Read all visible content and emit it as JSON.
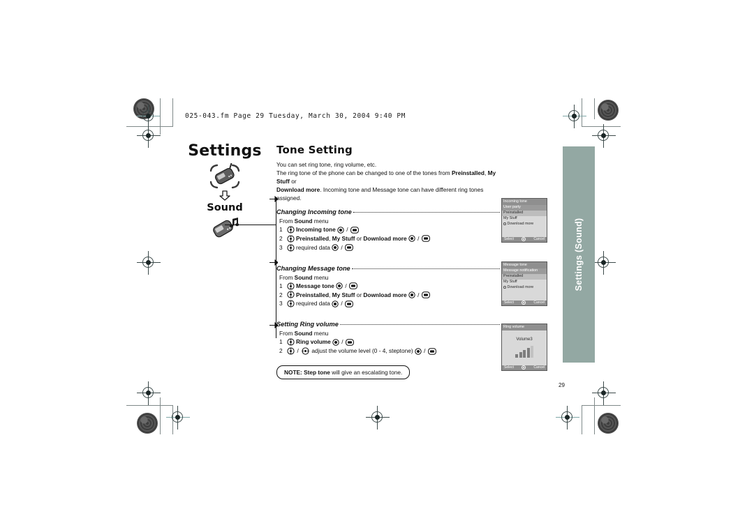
{
  "print_header": {
    "file_line": "025-043.fm  Page 29  Tuesday, March 30, 2004  9:40 PM"
  },
  "page_number": "29",
  "side_tab": {
    "label": "Settings (Sound)",
    "color": "#93a8a3"
  },
  "sidebar": {
    "chapter": "Settings",
    "arrow_icon": "down-arrow-icon",
    "section": "Sound",
    "chapter_icon": "phone-highlight-icon",
    "section_icon": "phone-music-note-icon"
  },
  "main": {
    "title": "Tone Setting",
    "intro_line1": "You can set ring tone, ring volume, etc.",
    "intro_line2_a": "The ring tone of the phone can be changed to one of the tones from ",
    "intro_line2_b1": "Preinstalled",
    "intro_line2_c": ", ",
    "intro_line2_b2": "My Stuff",
    "intro_line2_d": " or",
    "intro_line3_b": "Download more",
    "intro_line3_rest": ". Incoming tone and Message tone can have different ring tones assigned.",
    "sections": [
      {
        "heading": "Changing Incoming tone",
        "from_prefix": "From ",
        "from_bold": "Sound",
        "from_suffix": " menu",
        "steps": [
          {
            "num": "1",
            "nav_icon": "dpad-vertical-icon",
            "label_bold": "Incoming tone",
            "label_rest": "",
            "select_icon": "select-key-icon",
            "soft_icon": "soft-key-icon"
          },
          {
            "num": "2",
            "nav_icon": "dpad-vertical-icon",
            "label_bold": "Preinstalled",
            "label_mid": ", ",
            "label_bold2": "My Stuff",
            "label_or": " or ",
            "label_bold3": "Download more",
            "select_icon": "select-key-icon",
            "soft_icon": "soft-key-icon"
          },
          {
            "num": "3",
            "nav_icon": "dpad-vertical-icon",
            "label_plain": "required data",
            "select_icon": "select-key-icon",
            "soft_icon": "soft-key-icon"
          }
        ]
      },
      {
        "heading": "Changing Message tone",
        "from_prefix": "From ",
        "from_bold": "Sound",
        "from_suffix": " menu",
        "steps": [
          {
            "num": "1",
            "nav_icon": "dpad-vertical-icon",
            "label_bold": "Message tone",
            "select_icon": "select-key-icon",
            "soft_icon": "soft-key-icon"
          },
          {
            "num": "2",
            "nav_icon": "dpad-vertical-icon",
            "label_bold": "Preinstalled",
            "label_mid": ", ",
            "label_bold2": "My Stuff",
            "label_or": " or ",
            "label_bold3": "Download more",
            "select_icon": "select-key-icon",
            "soft_icon": "soft-key-icon"
          },
          {
            "num": "3",
            "nav_icon": "dpad-vertical-icon",
            "label_plain": "required data",
            "select_icon": "select-key-icon",
            "soft_icon": "soft-key-icon"
          }
        ]
      },
      {
        "heading": "Setting Ring volume",
        "from_prefix": "From ",
        "from_bold": "Sound",
        "from_suffix": " menu",
        "steps": [
          {
            "num": "1",
            "nav_icon": "dpad-vertical-icon",
            "label_bold": "Ring volume",
            "select_icon": "select-key-icon",
            "soft_icon": "soft-key-icon"
          },
          {
            "num": "2",
            "nav_icon": "dpad-vertical-icon",
            "nav_icon2": "dpad-horizontal-icon",
            "label_plain": "adjust the volume level (0 - 4, steptone)",
            "select_icon": "select-key-icon",
            "soft_icon": "soft-key-icon"
          }
        ]
      }
    ],
    "note": {
      "prefix": "NOTE: ",
      "bold": "Step tone",
      "rest": " will give an escalating tone."
    }
  },
  "phone_screens": [
    {
      "name": "incoming-tone-screen",
      "title": "Incoming tone",
      "rows": [
        {
          "text": "User party",
          "state": "selected"
        },
        {
          "text": "Preinstalled",
          "state": "shaded"
        },
        {
          "text": "My Stuff",
          "state": "normal"
        },
        {
          "text": "Download more",
          "state": "radio"
        }
      ],
      "softkey_left": "Select",
      "softkey_right": "Cancel"
    },
    {
      "name": "message-tone-screen",
      "title": "Message tone",
      "rows": [
        {
          "text": "Message notification",
          "state": "selected"
        },
        {
          "text": "Preinstalled",
          "state": "shaded"
        },
        {
          "text": "My Stuff",
          "state": "normal"
        },
        {
          "text": "Download more",
          "state": "radio"
        }
      ],
      "softkey_left": "Select",
      "softkey_right": "Cancel"
    },
    {
      "name": "ring-volume-screen",
      "title": "Ring volume",
      "volume_label": "Volume3",
      "volume_level": 3,
      "volume_max": 5,
      "softkey_left": "Select",
      "softkey_right": "Cancel"
    }
  ]
}
